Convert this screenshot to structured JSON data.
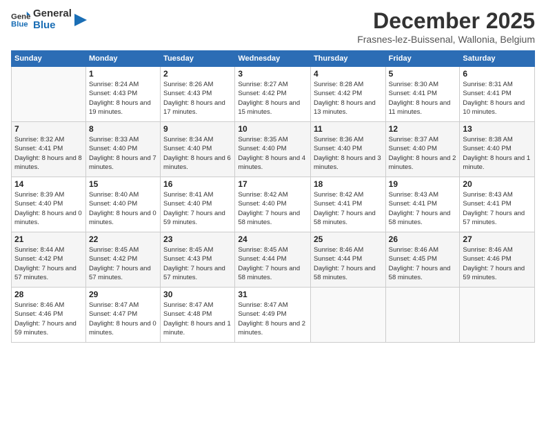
{
  "logo": {
    "text_general": "General",
    "text_blue": "Blue"
  },
  "title": "December 2025",
  "subtitle": "Frasnes-lez-Buissenal, Wallonia, Belgium",
  "days_header": [
    "Sunday",
    "Monday",
    "Tuesday",
    "Wednesday",
    "Thursday",
    "Friday",
    "Saturday"
  ],
  "weeks": [
    [
      {
        "day": "",
        "sunrise": "",
        "sunset": "",
        "daylight": ""
      },
      {
        "day": "1",
        "sunrise": "Sunrise: 8:24 AM",
        "sunset": "Sunset: 4:43 PM",
        "daylight": "Daylight: 8 hours and 19 minutes."
      },
      {
        "day": "2",
        "sunrise": "Sunrise: 8:26 AM",
        "sunset": "Sunset: 4:43 PM",
        "daylight": "Daylight: 8 hours and 17 minutes."
      },
      {
        "day": "3",
        "sunrise": "Sunrise: 8:27 AM",
        "sunset": "Sunset: 4:42 PM",
        "daylight": "Daylight: 8 hours and 15 minutes."
      },
      {
        "day": "4",
        "sunrise": "Sunrise: 8:28 AM",
        "sunset": "Sunset: 4:42 PM",
        "daylight": "Daylight: 8 hours and 13 minutes."
      },
      {
        "day": "5",
        "sunrise": "Sunrise: 8:30 AM",
        "sunset": "Sunset: 4:41 PM",
        "daylight": "Daylight: 8 hours and 11 minutes."
      },
      {
        "day": "6",
        "sunrise": "Sunrise: 8:31 AM",
        "sunset": "Sunset: 4:41 PM",
        "daylight": "Daylight: 8 hours and 10 minutes."
      }
    ],
    [
      {
        "day": "7",
        "sunrise": "Sunrise: 8:32 AM",
        "sunset": "Sunset: 4:41 PM",
        "daylight": "Daylight: 8 hours and 8 minutes."
      },
      {
        "day": "8",
        "sunrise": "Sunrise: 8:33 AM",
        "sunset": "Sunset: 4:40 PM",
        "daylight": "Daylight: 8 hours and 7 minutes."
      },
      {
        "day": "9",
        "sunrise": "Sunrise: 8:34 AM",
        "sunset": "Sunset: 4:40 PM",
        "daylight": "Daylight: 8 hours and 6 minutes."
      },
      {
        "day": "10",
        "sunrise": "Sunrise: 8:35 AM",
        "sunset": "Sunset: 4:40 PM",
        "daylight": "Daylight: 8 hours and 4 minutes."
      },
      {
        "day": "11",
        "sunrise": "Sunrise: 8:36 AM",
        "sunset": "Sunset: 4:40 PM",
        "daylight": "Daylight: 8 hours and 3 minutes."
      },
      {
        "day": "12",
        "sunrise": "Sunrise: 8:37 AM",
        "sunset": "Sunset: 4:40 PM",
        "daylight": "Daylight: 8 hours and 2 minutes."
      },
      {
        "day": "13",
        "sunrise": "Sunrise: 8:38 AM",
        "sunset": "Sunset: 4:40 PM",
        "daylight": "Daylight: 8 hours and 1 minute."
      }
    ],
    [
      {
        "day": "14",
        "sunrise": "Sunrise: 8:39 AM",
        "sunset": "Sunset: 4:40 PM",
        "daylight": "Daylight: 8 hours and 0 minutes."
      },
      {
        "day": "15",
        "sunrise": "Sunrise: 8:40 AM",
        "sunset": "Sunset: 4:40 PM",
        "daylight": "Daylight: 8 hours and 0 minutes."
      },
      {
        "day": "16",
        "sunrise": "Sunrise: 8:41 AM",
        "sunset": "Sunset: 4:40 PM",
        "daylight": "Daylight: 7 hours and 59 minutes."
      },
      {
        "day": "17",
        "sunrise": "Sunrise: 8:42 AM",
        "sunset": "Sunset: 4:40 PM",
        "daylight": "Daylight: 7 hours and 58 minutes."
      },
      {
        "day": "18",
        "sunrise": "Sunrise: 8:42 AM",
        "sunset": "Sunset: 4:41 PM",
        "daylight": "Daylight: 7 hours and 58 minutes."
      },
      {
        "day": "19",
        "sunrise": "Sunrise: 8:43 AM",
        "sunset": "Sunset: 4:41 PM",
        "daylight": "Daylight: 7 hours and 58 minutes."
      },
      {
        "day": "20",
        "sunrise": "Sunrise: 8:43 AM",
        "sunset": "Sunset: 4:41 PM",
        "daylight": "Daylight: 7 hours and 57 minutes."
      }
    ],
    [
      {
        "day": "21",
        "sunrise": "Sunrise: 8:44 AM",
        "sunset": "Sunset: 4:42 PM",
        "daylight": "Daylight: 7 hours and 57 minutes."
      },
      {
        "day": "22",
        "sunrise": "Sunrise: 8:45 AM",
        "sunset": "Sunset: 4:42 PM",
        "daylight": "Daylight: 7 hours and 57 minutes."
      },
      {
        "day": "23",
        "sunrise": "Sunrise: 8:45 AM",
        "sunset": "Sunset: 4:43 PM",
        "daylight": "Daylight: 7 hours and 57 minutes."
      },
      {
        "day": "24",
        "sunrise": "Sunrise: 8:45 AM",
        "sunset": "Sunset: 4:44 PM",
        "daylight": "Daylight: 7 hours and 58 minutes."
      },
      {
        "day": "25",
        "sunrise": "Sunrise: 8:46 AM",
        "sunset": "Sunset: 4:44 PM",
        "daylight": "Daylight: 7 hours and 58 minutes."
      },
      {
        "day": "26",
        "sunrise": "Sunrise: 8:46 AM",
        "sunset": "Sunset: 4:45 PM",
        "daylight": "Daylight: 7 hours and 58 minutes."
      },
      {
        "day": "27",
        "sunrise": "Sunrise: 8:46 AM",
        "sunset": "Sunset: 4:46 PM",
        "daylight": "Daylight: 7 hours and 59 minutes."
      }
    ],
    [
      {
        "day": "28",
        "sunrise": "Sunrise: 8:46 AM",
        "sunset": "Sunset: 4:46 PM",
        "daylight": "Daylight: 7 hours and 59 minutes."
      },
      {
        "day": "29",
        "sunrise": "Sunrise: 8:47 AM",
        "sunset": "Sunset: 4:47 PM",
        "daylight": "Daylight: 8 hours and 0 minutes."
      },
      {
        "day": "30",
        "sunrise": "Sunrise: 8:47 AM",
        "sunset": "Sunset: 4:48 PM",
        "daylight": "Daylight: 8 hours and 1 minute."
      },
      {
        "day": "31",
        "sunrise": "Sunrise: 8:47 AM",
        "sunset": "Sunset: 4:49 PM",
        "daylight": "Daylight: 8 hours and 2 minutes."
      },
      {
        "day": "",
        "sunrise": "",
        "sunset": "",
        "daylight": ""
      },
      {
        "day": "",
        "sunrise": "",
        "sunset": "",
        "daylight": ""
      },
      {
        "day": "",
        "sunrise": "",
        "sunset": "",
        "daylight": ""
      }
    ]
  ]
}
